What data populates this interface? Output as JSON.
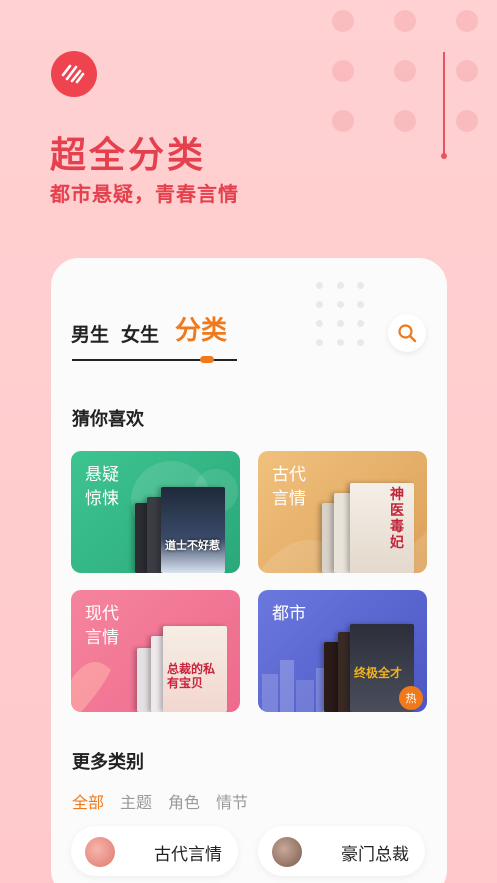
{
  "header": {
    "logo_icon": "app-logo-icon",
    "title": "超全分类",
    "subtitle": "都市悬疑，青春言情"
  },
  "tabs": [
    {
      "label": "男生",
      "active": false
    },
    {
      "label": "女生",
      "active": false
    },
    {
      "label": "分类",
      "active": true
    }
  ],
  "search": {
    "icon": "search-icon"
  },
  "guess": {
    "title": "猜你喜欢",
    "categories": [
      {
        "label": "悬疑惊悚",
        "book_title": "道士不好惹",
        "color": "#3cbf8e"
      },
      {
        "label": "古代言情",
        "book_title": "神医毒妃",
        "color": "#e9b16b"
      },
      {
        "label": "现代言情",
        "book_title": "总裁的私有宝贝",
        "color": "#f27999"
      },
      {
        "label": "都市",
        "book_title": "终极全才",
        "color": "#5a6ad3",
        "badge": "热"
      }
    ]
  },
  "more": {
    "title": "更多类别",
    "filters": [
      {
        "label": "全部",
        "active": true
      },
      {
        "label": "主题",
        "active": false
      },
      {
        "label": "角色",
        "active": false
      },
      {
        "label": "情节",
        "active": false
      }
    ],
    "items": [
      {
        "label": "古代言情"
      },
      {
        "label": "豪门总裁"
      }
    ]
  },
  "colors": {
    "accent": "#f07a1b",
    "brand": "#e5404d",
    "background": "#ffd1d2"
  }
}
